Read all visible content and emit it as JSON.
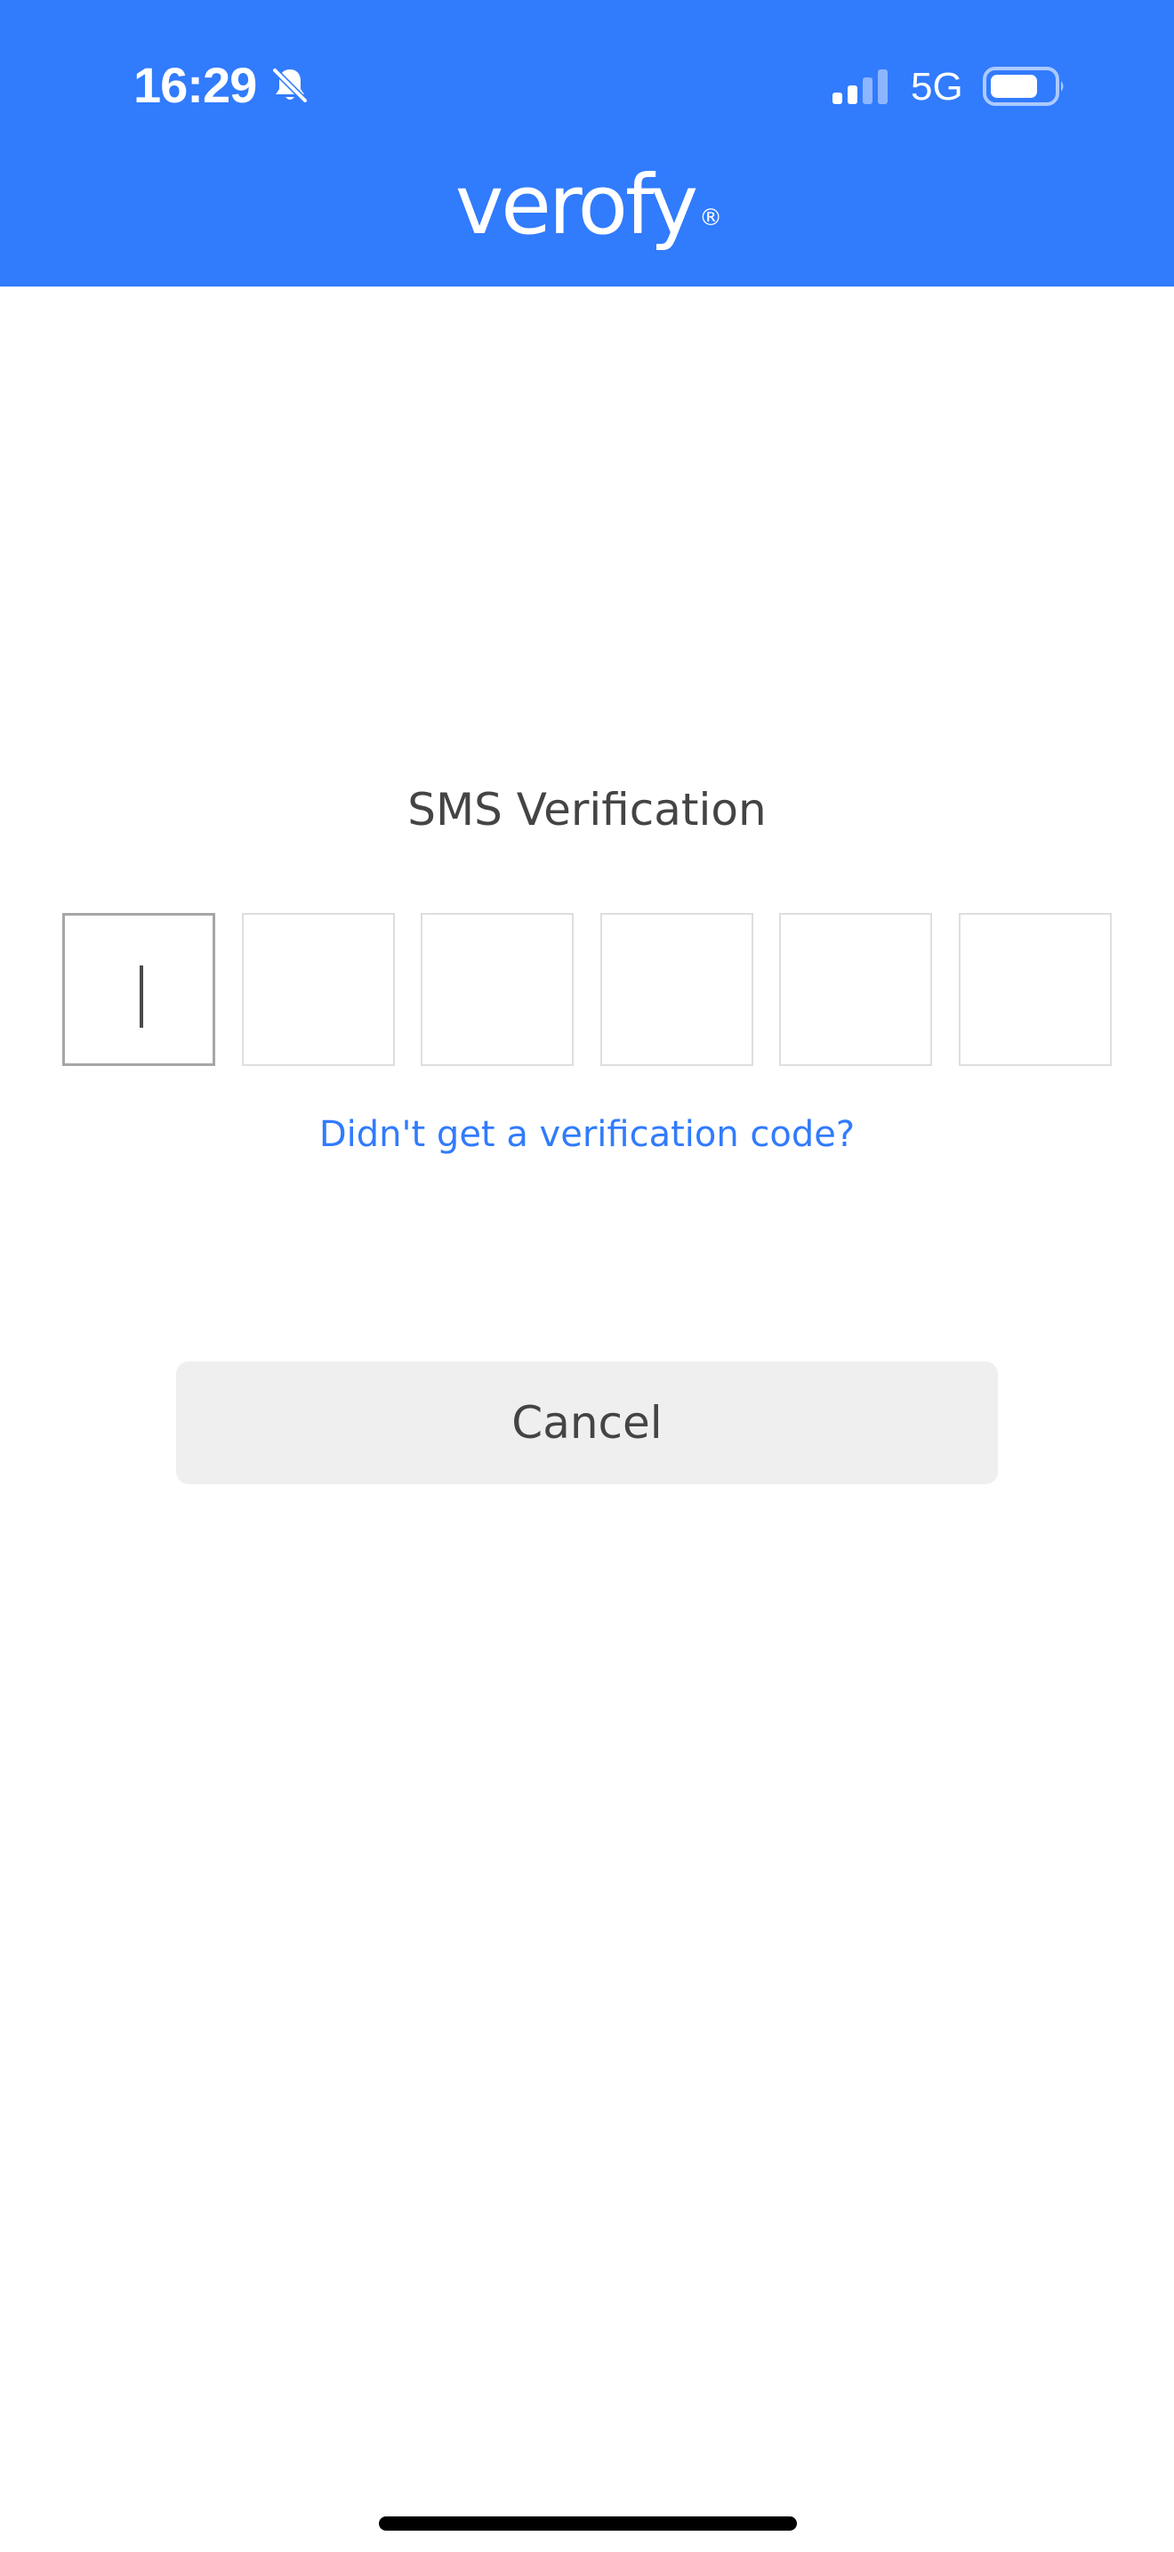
{
  "status_bar": {
    "time": "16:29",
    "network": "5G",
    "icons": [
      "bell-muted-icon",
      "signal-icon",
      "battery-icon"
    ]
  },
  "header": {
    "logo_text": "verofy",
    "logo_mark": "®",
    "background_color": "#317bfd"
  },
  "main": {
    "title": "SMS Verification",
    "code_length": 6,
    "code_values": [
      "",
      "",
      "",
      "",
      "",
      ""
    ],
    "resend_link": "Didn't get a verification code?",
    "cancel_label": "Cancel",
    "link_color": "#317bfd"
  }
}
